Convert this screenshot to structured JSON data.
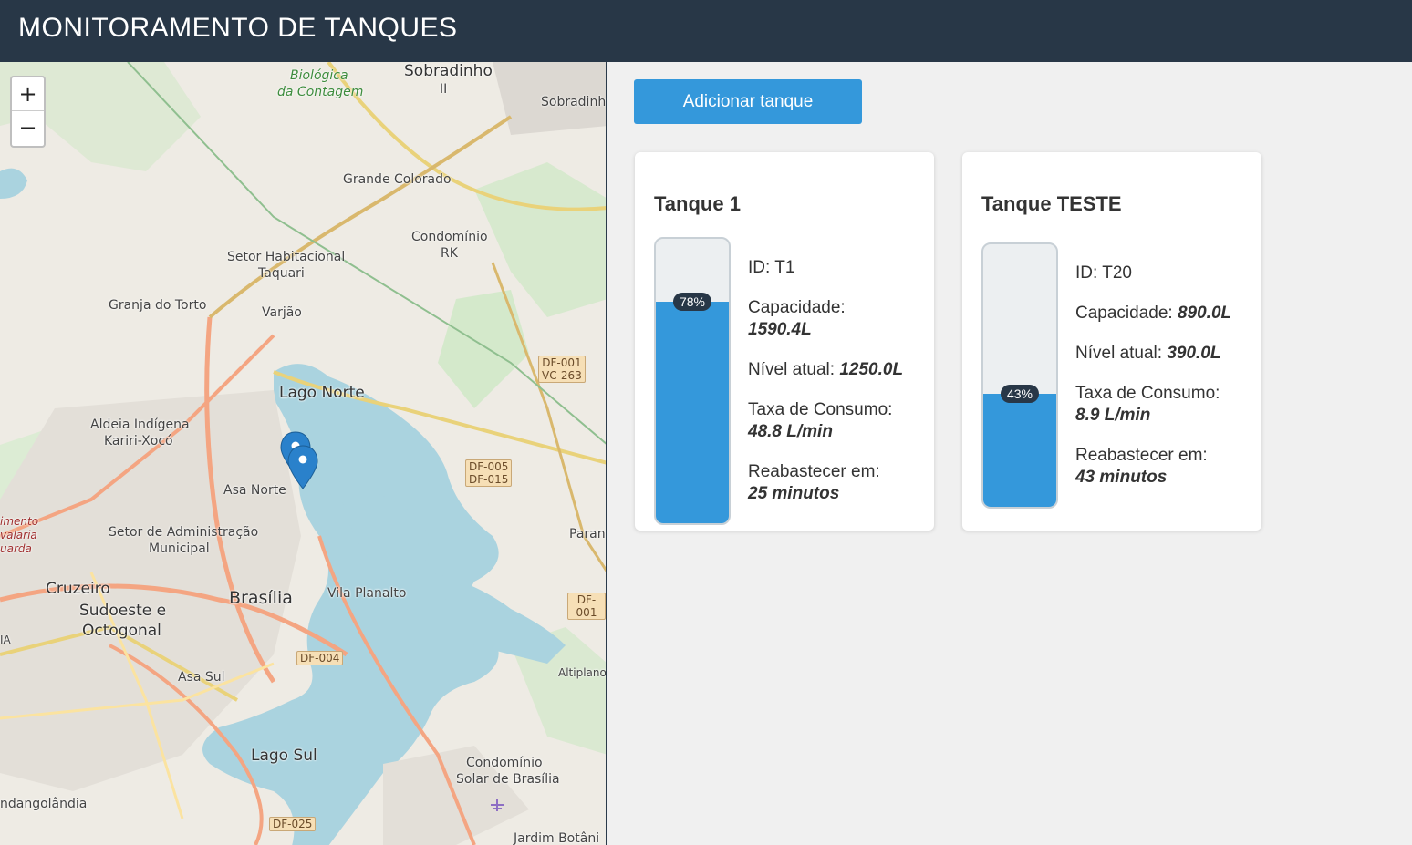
{
  "header": {
    "title": "MONITORAMENTO DE TANQUES"
  },
  "map": {
    "zoom_in": "+",
    "zoom_out": "−",
    "labels": {
      "biologica": "Biológica",
      "contagem": "da Contagem",
      "sobradinho2a": "Sobradinho",
      "sobradinho2b": "II",
      "sobradinho": "Sobradinh",
      "grande_colorado": "Grande Colorado",
      "setor_hab": "Setor Habitacional",
      "taquari": "Taquari",
      "condominio_rk": "Condomínio",
      "rk": "RK",
      "granja": "Granja do Torto",
      "varjao": "Varjão",
      "lago_norte": "Lago Norte",
      "aldeia": "Aldeia Indígena",
      "kariri": "Kariri-Xocó",
      "asa_norte": "Asa Norte",
      "setor_adm": "Setor de Administração",
      "municipal": "Municipal",
      "cruzeiro": "Cruzeiro",
      "sudoeste": "Sudoeste e",
      "octogonal": "Octogonal",
      "brasilia": "Brasília",
      "vila_planalto": "Vila Planalto",
      "asa_sul": "Asa Sul",
      "lago_sul": "Lago Sul",
      "cond_solar": "Condomínio",
      "solar": "Solar de Brasília",
      "candangolandia": "ndangolândia",
      "jardim": "Jardim Botâni",
      "altiplano": "Altiplano",
      "parano": "Paran",
      "imento": "imento",
      "avalaria": "valaria",
      "uarda": "uarda",
      "ia": "IA"
    },
    "shields": {
      "df001a": "DF-001",
      "vc263": "VC-263",
      "df005": "DF-005",
      "df015": "DF-015",
      "df001b": "DF-001",
      "df004": "DF-004",
      "df025": "DF-025"
    }
  },
  "actions": {
    "add_tank": "Adicionar tanque"
  },
  "tanks": [
    {
      "name": "Tanque 1",
      "level_pct": 78,
      "level_label": "78%",
      "id_label": "ID: T1",
      "capacity_label": "Capacidade:",
      "capacity": "1590.4L",
      "level_text_label": "Nível atual:",
      "level": "1250.0L",
      "rate_label": "Taxa de Consumo:",
      "rate": "48.8 L/min",
      "refill_label": "Reabastecer em:",
      "refill": "25 minutos"
    },
    {
      "name": "Tanque TESTE",
      "level_pct": 43,
      "level_label": "43%",
      "id_label": "ID: T20",
      "capacity_label": "Capacidade:",
      "capacity": "890.0L",
      "level_text_label": "Nível atual:",
      "level": "390.0L",
      "rate_label": "Taxa de Consumo:",
      "rate": "8.9 L/min",
      "refill_label": "Reabastecer em:",
      "refill": "43 minutos"
    }
  ],
  "colors": {
    "header": "#283747",
    "accent": "#3498db",
    "water": "#aad3df"
  }
}
